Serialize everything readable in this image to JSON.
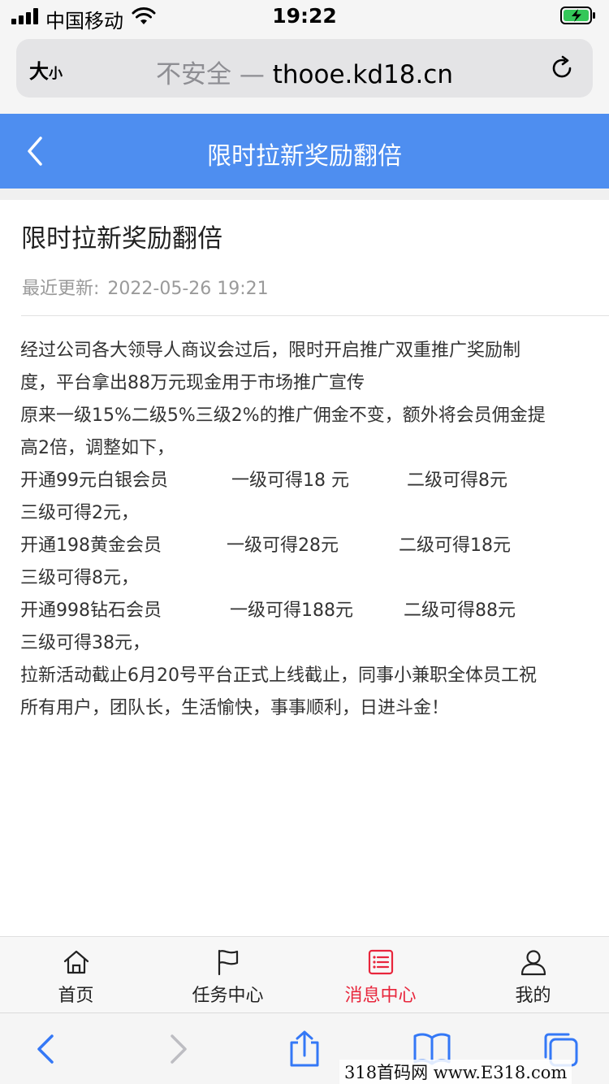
{
  "status_bar": {
    "carrier": "中国移动",
    "time": "19:22"
  },
  "browser": {
    "text_size_big": "大",
    "text_size_small": "小",
    "insecure_label": "不安全 —",
    "domain": "thooe.kd18.cn"
  },
  "header": {
    "title": "限时拉新奖励翻倍"
  },
  "article": {
    "title": "限时拉新奖励翻倍",
    "updated_label": "最近更新:",
    "updated_value": "2022-05-26 19:21",
    "lines": [
      "经过公司各大领导人商议会过后，限时开启推广双重推广奖励制",
      "度，平台拿出88万元现金用于市场推广宣传",
      "原来一级15%二级5%三级2%的推广佣金不变，额外将会员佣金提",
      "高2倍，调整如下，"
    ],
    "tiers": [
      {
        "name": "开通99元白银会员",
        "level1": "一级可得18 元",
        "level2": "二级可得8元",
        "level3": "三级可得2元，"
      },
      {
        "name": "开通198黄金会员",
        "level1": "一级可得28元",
        "level2": "二级可得18元",
        "level3": "三级可得8元，"
      },
      {
        "name": "开通998钻石会员",
        "level1": "一级可得188元",
        "level2": "二级可得88元",
        "level3": "三级可得38元，"
      }
    ],
    "closing_lines": [
      "拉新活动截止6月20号平台正式上线截止，同事小兼职全体员工祝",
      "所有用户，团队长，生活愉快，事事顺利，日进斗金！"
    ]
  },
  "tabs": [
    {
      "label": "首页",
      "icon": "home-icon"
    },
    {
      "label": "任务中心",
      "icon": "flag-icon"
    },
    {
      "label": "消息中心",
      "icon": "message-list-icon",
      "active": true
    },
    {
      "label": "我的",
      "icon": "user-icon"
    }
  ],
  "colors": {
    "header_blue": "#4e8ef0",
    "active_tab_red": "#e8263c",
    "ios_blue": "#3478f6"
  },
  "watermark": "318首码网 www.E318.com"
}
